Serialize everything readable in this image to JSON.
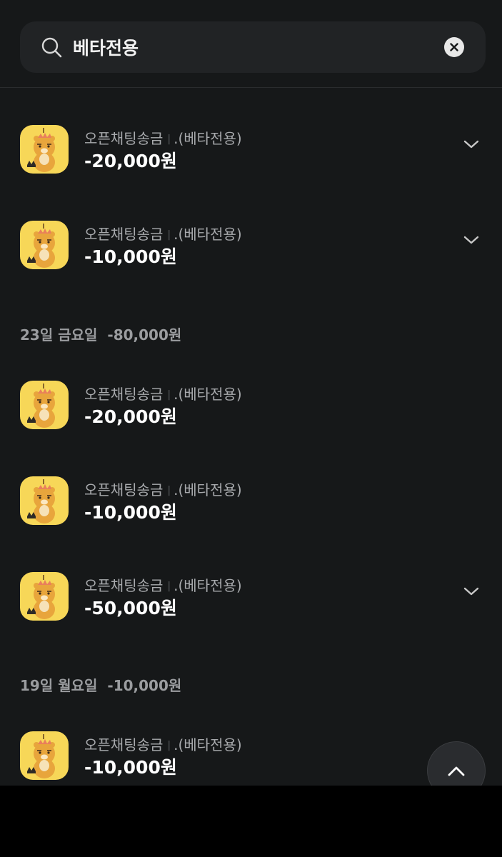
{
  "search": {
    "value": "베타전용",
    "icon": "search-icon",
    "clear_icon": "clear-icon"
  },
  "top_items": [
    {
      "title": "오픈채팅송금",
      "separator": "|",
      "subtitle": ".(베타전용)",
      "amount": "-20,000원",
      "expandable": true
    },
    {
      "title": "오픈채팅송금",
      "separator": "|",
      "subtitle": ".(베타전용)",
      "amount": "-10,000원",
      "expandable": true
    }
  ],
  "groups": [
    {
      "date": "23일 금요일",
      "total": "-80,000원",
      "items": [
        {
          "title": "오픈채팅송금",
          "separator": "|",
          "subtitle": ".(베타전용)",
          "amount": "-20,000원",
          "expandable": false
        },
        {
          "title": "오픈채팅송금",
          "separator": "|",
          "subtitle": ".(베타전용)",
          "amount": "-10,000원",
          "expandable": false
        },
        {
          "title": "오픈채팅송금",
          "separator": "|",
          "subtitle": ".(베타전용)",
          "amount": "-50,000원",
          "expandable": true
        }
      ]
    },
    {
      "date": "19일 월요일",
      "total": "-10,000원",
      "items": [
        {
          "title": "오픈채팅송금",
          "separator": "|",
          "subtitle": ".(베타전용)",
          "amount": "-10,000원",
          "expandable": false
        }
      ]
    }
  ],
  "colors": {
    "background": "#161819",
    "avatar": "#f7d758",
    "character": "#e8a53c"
  },
  "scroll_top_icon": "chevron-up-icon"
}
